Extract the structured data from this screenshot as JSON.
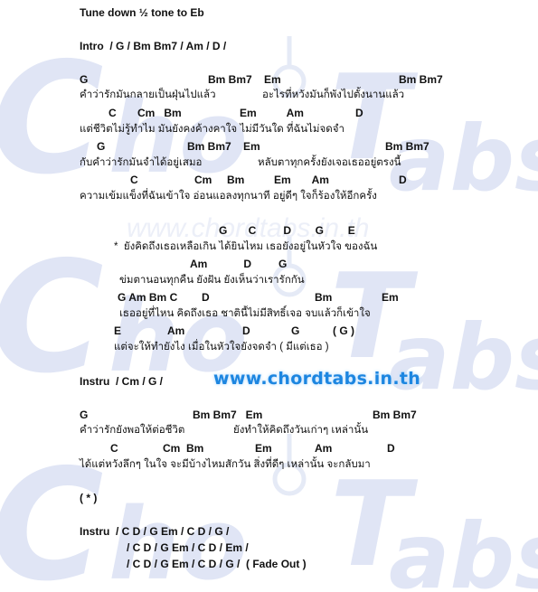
{
  "title": "Tune down ½ tone to Eb",
  "intro": "Intro  / G / Bm Bm7 / Am / D /",
  "watermark": "Chord Tabs",
  "watermark_url": "www.chordtabs.in.th",
  "site_url": "www.chordtabs.in.th",
  "verse1": [
    {
      "chords": "G",
      "lyrics": "คำว่ารักมันกลายเป็นฝุ่นไปแล้ว"
    },
    {
      "chords2": "Bm Bm7    Em",
      "lyrics2": "อะไรที่หวังมันก็พังไปตั้งนานแล้ว",
      "chords3": "Bm Bm7"
    },
    {
      "chords": "C       Cm   Bm",
      "chords_b": "Em          Am",
      "chords_c": "D",
      "lyrics": "แต่ชีวิตไม่รู้ทำไม มันยังคงค้างคาใจ ไม่มีวันใด ที่ฉันไม่จดจำ"
    },
    {
      "chords": "G",
      "chords_b": "Bm Bm7    Em",
      "chords_c": "Bm Bm7",
      "lyrics": "กับคำว่ารักมันจำได้อยู่เสมอ",
      "lyrics_b": "หลับตาทุกครั้งยังเจอเธออยู่ตรงนี้"
    },
    {
      "chords": "C",
      "chords_b": "Cm     Bm",
      "chords_c": "Em       Am",
      "chords_d": "D",
      "lyrics": "ความเข้มแข็งที่ฉันเข้าใจ อ่อนแอลงทุกนาที อยู่ดีๆ ใจก็ร้องให้อีกครั้ง"
    }
  ],
  "chorus": [
    {
      "chords": "G       C         D        G        E",
      "lyrics": "*  ยังคิดถึงเธอเหลือเกิน ได้ยินไหม เธอยังอยู่ในหัวใจ ของฉัน"
    },
    {
      "chords": "Am            D         G",
      "lyrics": "ข่มตานอนทุกคืน ยังฝัน ยังเห็นว่าเรารักกัน"
    },
    {
      "chords": "G Am Bm C",
      "chords_b": "D",
      "chords_c": "Bm",
      "chords_d": "Em",
      "lyrics": "เธออยู่ที่ไหน คิดถึงเธอ ชาตินี้ไม่มีสิทธิ์เจอ จบแล้วก็เข้าใจ"
    },
    {
      "chords": "E",
      "chords_b": "Am",
      "chords_c": "D",
      "chords_d": "G",
      "chords_e": "( G )",
      "lyrics": "แต่จะให้ทำยังไง เมื่อในหัวใจยังจดจำ ( มีแต่เธอ )"
    }
  ],
  "instru1": "Instru  / Cm / G /",
  "verse2": [
    {
      "chords": "G",
      "chords_b": "Bm Bm7   Em",
      "chords_c": "Bm Bm7",
      "lyrics": "คำว่ารักยังพอให้ต่อชีวิต",
      "lyrics_b": "ยังทำให้คิดถึงวันเก่าๆ เหล่านั้น"
    },
    {
      "chords": "C",
      "chords_b": "Cm  Bm",
      "chords_c": "Em",
      "chords_d": "Am",
      "chords_e": "D",
      "lyrics": "ได้แต่หวังลึกๆ ในใจ จะมีบ้างไหมสักวัน สิ่งที่ดีๆ เหล่านั้น จะกลับมา"
    }
  ],
  "chorus_repeat": "( * )",
  "outro": {
    "line1": "Instru  / C D / G Em / C D / G /",
    "line2": "/ C D / G Em / C D / Em /",
    "line3": "/ C D / G Em / C D / G /  ( Fade Out )"
  }
}
